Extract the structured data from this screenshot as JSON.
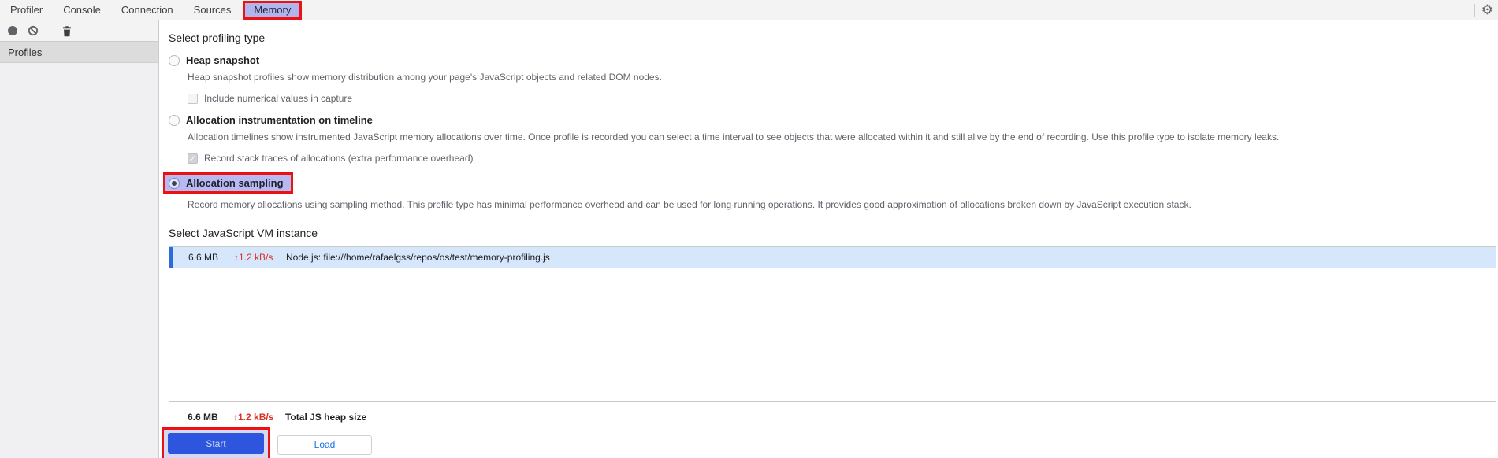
{
  "tabs": [
    {
      "label": "Profiler"
    },
    {
      "label": "Console"
    },
    {
      "label": "Connection"
    },
    {
      "label": "Sources"
    },
    {
      "label": "Memory",
      "selected": true,
      "annotated": true
    }
  ],
  "toolbar": {
    "icons": [
      {
        "name": "record-icon"
      },
      {
        "name": "clear-icon"
      },
      {
        "name": "delete-icon"
      }
    ]
  },
  "sidebar": {
    "header": "Profiles"
  },
  "main": {
    "profiling": {
      "heading": "Select profiling type",
      "options": [
        {
          "label": "Heap snapshot",
          "selected": false,
          "description": "Heap snapshot profiles show memory distribution among your page's JavaScript objects and related DOM nodes.",
          "checkbox": {
            "label": "Include numerical values in capture",
            "checked": false
          }
        },
        {
          "label": "Allocation instrumentation on timeline",
          "selected": false,
          "description": "Allocation timelines show instrumented JavaScript memory allocations over time. Once profile is recorded you can select a time interval to see objects that were allocated within it and still alive by the end of recording. Use this profile type to isolate memory leaks.",
          "checkbox": {
            "label": "Record stack traces of allocations (extra performance overhead)",
            "checked": true,
            "disabled": true
          }
        },
        {
          "label": "Allocation sampling",
          "selected": true,
          "annotated": true,
          "description": "Record memory allocations using sampling method. This profile type has minimal performance overhead and can be used for long running operations. It provides good approximation of allocations broken down by JavaScript execution stack."
        }
      ]
    },
    "vm": {
      "heading": "Select JavaScript VM instance",
      "rows": [
        {
          "size": "6.6 MB",
          "rate": "↑1.2 kB/s",
          "name": "Node.js: file:///home/rafaelgss/repos/os/test/memory-profiling.js",
          "selected": true
        }
      ],
      "total": {
        "size": "6.6 MB",
        "rate": "↑1.2 kB/s",
        "label": "Total JS heap size"
      }
    },
    "actions": {
      "start": "Start",
      "load": "Load"
    }
  },
  "icons": {
    "settings": "⚙",
    "record": "filled-circle",
    "clear": "circle-slash",
    "delete": "trash-can"
  },
  "colors": {
    "annotation_red": "#ee1111",
    "annotation_lavender": "#b1b5ee",
    "selected_row_bg": "#d6e6fb",
    "selected_row_bar": "#2e6bd8",
    "stat_red": "#d93025",
    "start_button_blue": "#2d55dd",
    "load_text_blue": "#1a73e8",
    "chrome_bg": "#f3f3f3"
  }
}
